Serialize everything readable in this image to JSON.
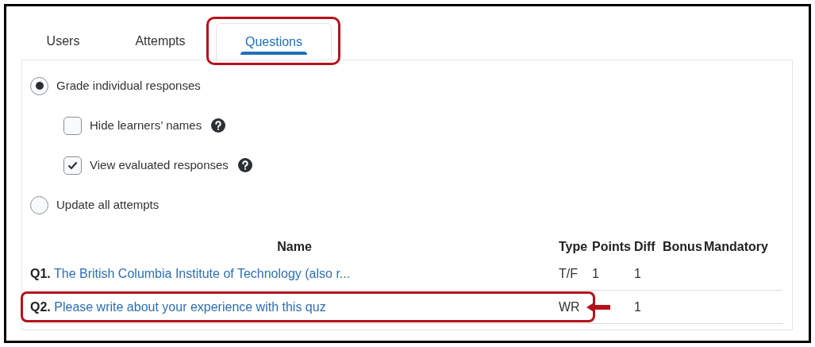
{
  "tabs": [
    {
      "label": "Users",
      "selected": false,
      "highlighted": false
    },
    {
      "label": "Attempts",
      "selected": false,
      "highlighted": false
    },
    {
      "label": "Questions",
      "selected": true,
      "highlighted": true
    }
  ],
  "grading_options": [
    {
      "kind": "radio",
      "label": "Grade individual responses",
      "selected": true
    },
    {
      "kind": "checkbox",
      "label": "Hide learners’ names",
      "checked": false,
      "help": true
    },
    {
      "kind": "checkbox",
      "label": "View evaluated responses",
      "checked": true,
      "help": true
    },
    {
      "kind": "radio",
      "label": "Update all attempts",
      "selected": false
    }
  ],
  "table": {
    "columns": [
      "Name",
      "Type",
      "Points",
      "Diff",
      "Bonus",
      "Mandatory"
    ],
    "rows": [
      {
        "number": "Q1.",
        "name": "The British Columbia Institute of Technology (also r...",
        "type": "T/F",
        "points": "1",
        "diff": "1",
        "highlighted": false,
        "arrow": false
      },
      {
        "number": "Q2.",
        "name": "Please write about your experience with this quz",
        "type": "WR",
        "diff": "1",
        "highlighted": true,
        "arrow": true
      }
    ]
  }
}
